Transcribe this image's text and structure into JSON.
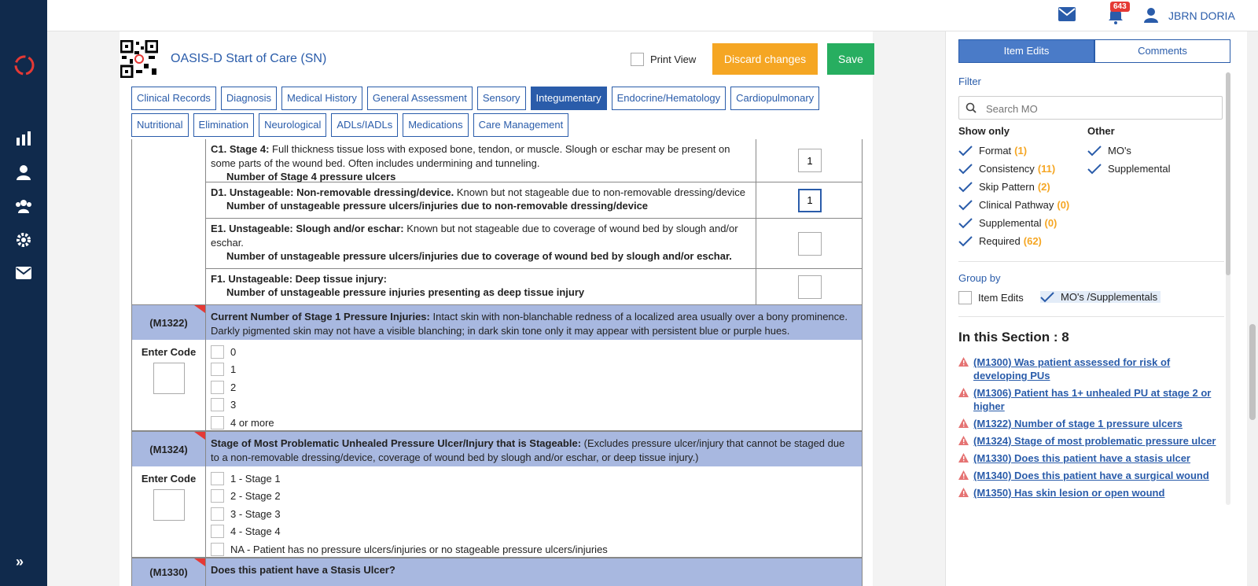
{
  "colors": {
    "nav_bg": "#102a4c",
    "accent": "#2a5caa",
    "discard": "#f5a623",
    "save": "#27ae60",
    "header_row": "#a8b8e0",
    "badge": "#e53935"
  },
  "topbar": {
    "notifications_count": "643",
    "user_name": "JBRN DORIA",
    "icons": [
      "mail-icon",
      "bell-icon",
      "user-icon"
    ]
  },
  "nav": {
    "icons": [
      "logo-icon",
      "chart-icon",
      "patient-icon",
      "team-icon",
      "gear-icon",
      "mail-icon",
      "expand-icon"
    ],
    "expand_label": "»"
  },
  "header": {
    "title": "OASIS-D Start of Care (SN)",
    "print_view_label": "Print View",
    "discard_label": "Discard changes",
    "save_label": "Save"
  },
  "tabs_row1": [
    "Clinical Records",
    "Diagnosis",
    "Medical History",
    "General Assessment",
    "Sensory",
    "Integumentary",
    "Endocrine/Hematology",
    "Cardiopulmonary"
  ],
  "tabs_row2": [
    "Nutritional",
    "Elimination",
    "Neurological",
    "ADLs/IADLs",
    "Medications",
    "Care Management"
  ],
  "active_tab": "Integumentary",
  "stages": [
    {
      "code": "C1. Stage 4:",
      "desc": " Full thickness tissue loss with exposed bone, tendon, or muscle. Slough or eschar may be present on some parts of the wound bed. Often includes undermining and tunneling.",
      "sub": "Number of Stage 4 pressure ulcers",
      "value": "1"
    },
    {
      "code": "D1. Unstageable: Non-removable dressing/device.",
      "desc": " Known but not stageable due to non-removable dressing/device",
      "sub": "Number of unstageable pressure ulcers/injuries due to non-removable dressing/device",
      "value": "1"
    },
    {
      "code": "E1. Unstageable: Slough and/or eschar:",
      "desc": " Known but not stageable due to coverage of wound bed by slough and/or eschar.",
      "sub": "Number of unstageable pressure ulcers/injuries due to coverage of wound bed by slough and/or eschar.",
      "value": ""
    },
    {
      "code": "F1. Unstageable: Deep tissue injury:",
      "desc": "",
      "sub": "Number of unstageable pressure injuries presenting as deep tissue injury",
      "value": ""
    }
  ],
  "m1322": {
    "code": "(M1322)",
    "title": "Current Number of Stage 1 Pressure Injuries:",
    "desc": " Intact skin with non-blanchable redness of a localized area usually over a bony prominence. Darkly pigmented skin may not have a visible blanching; in dark skin tone only it may appear with persistent blue or purple hues.",
    "enter_code": "Enter Code",
    "options": [
      "0",
      "1",
      "2",
      "3",
      "4 or more"
    ]
  },
  "m1324": {
    "code": "(M1324)",
    "title": "Stage of Most Problematic Unhealed Pressure Ulcer/Injury that is Stageable:",
    "desc": " (Excludes pressure ulcer/injury that cannot be staged due to a non-removable dressing/device, coverage of wound bed by slough and/or eschar, or deep tissue injury.)",
    "enter_code": "Enter Code",
    "options": [
      "1 - Stage 1",
      "2 - Stage 2",
      "3 - Stage 3",
      "4 - Stage 4",
      "NA - Patient has no pressure ulcers/injuries or no stageable pressure ulcers/injuries"
    ]
  },
  "m1330": {
    "code": "(M1330)",
    "title": "Does this patient have a Stasis Ulcer?"
  },
  "sidebar": {
    "tabs": [
      "Item Edits",
      "Comments"
    ],
    "filter_label": "Filter",
    "search_placeholder": "Search MO",
    "show_only_label": "Show only",
    "other_label": "Other",
    "show_only": [
      {
        "label": "Format",
        "count": "(1)"
      },
      {
        "label": "Consistency",
        "count": "(11)"
      },
      {
        "label": "Skip Pattern",
        "count": "(2)"
      },
      {
        "label": "Clinical Pathway",
        "count": "(0)"
      },
      {
        "label": "Supplemental",
        "count": "(0)"
      },
      {
        "label": "Required",
        "count": "(62)"
      }
    ],
    "other": [
      "MO's",
      "Supplemental"
    ],
    "group_by_label": "Group by",
    "group_by": [
      "Item Edits",
      "MO's /Supplementals"
    ],
    "section_title": "In this Section : 8",
    "links": [
      "(M1300) Was patient assessed for risk of developing PUs",
      "(M1306) Patient has 1+ unhealed PU at stage 2 or higher",
      "(M1322) Number of stage 1 pressure ulcers",
      "(M1324) Stage of most problematic pressure ulcer",
      "(M1330) Does this patient have a stasis ulcer",
      "(M1340) Does this patient have a surgical wound",
      "(M1350) Has skin lesion or open wound"
    ]
  }
}
